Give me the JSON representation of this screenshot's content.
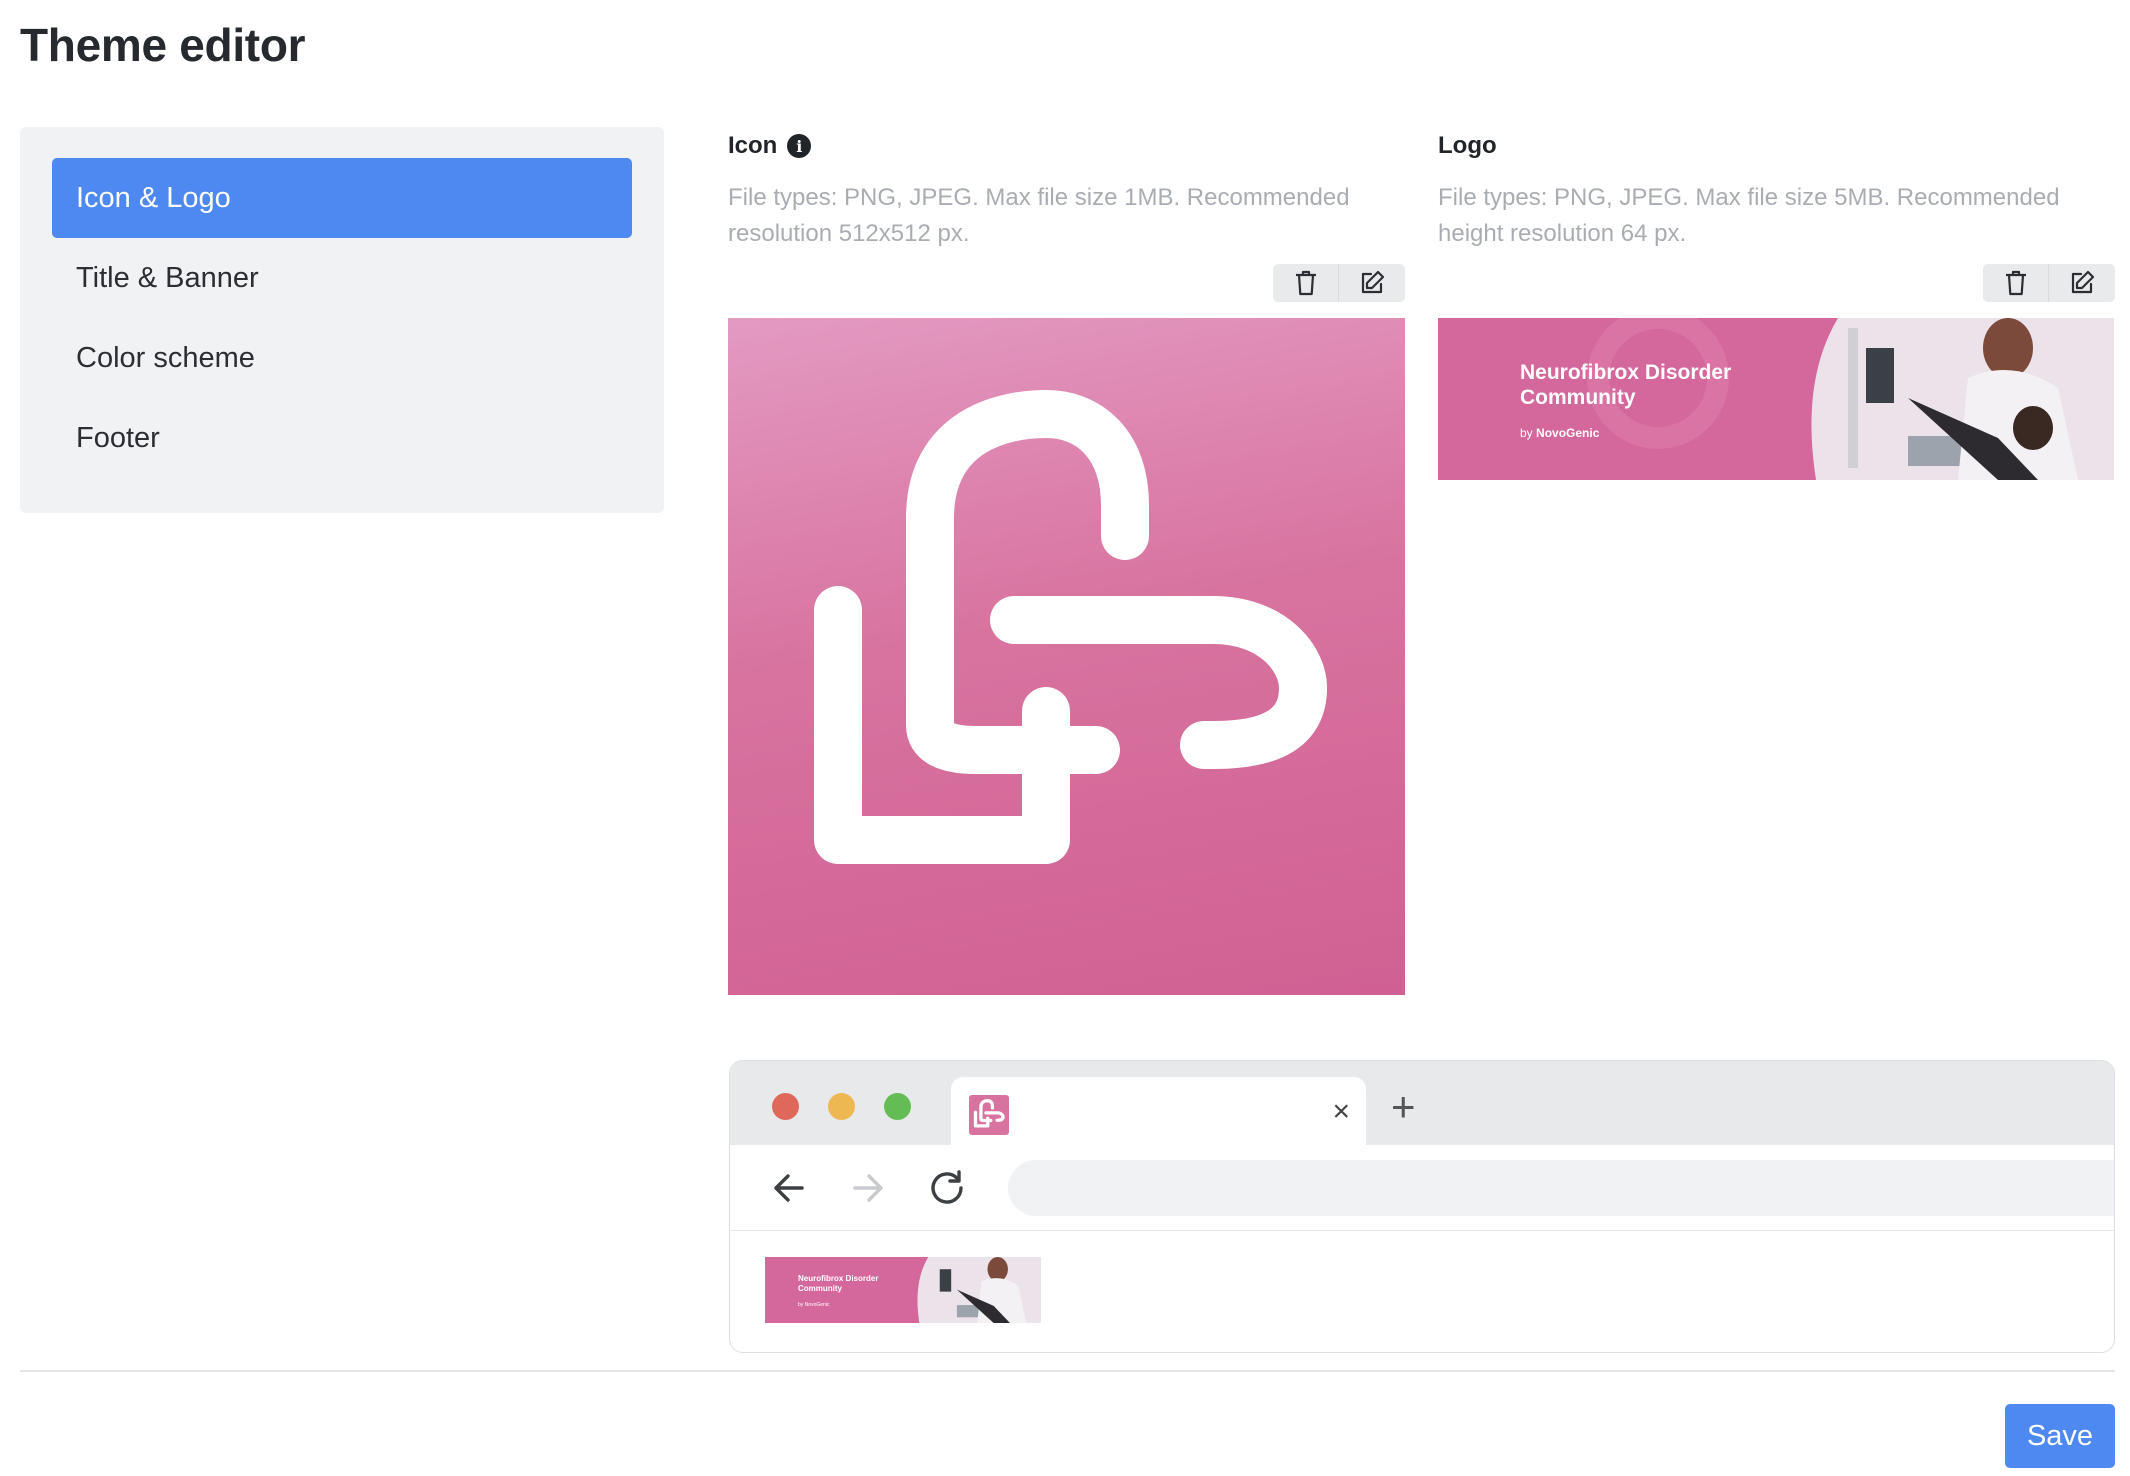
{
  "page": {
    "title": "Theme editor"
  },
  "sidebar": {
    "items": [
      {
        "label": "Icon & Logo",
        "active": true
      },
      {
        "label": "Title & Banner",
        "active": false
      },
      {
        "label": "Color scheme",
        "active": false
      },
      {
        "label": "Footer",
        "active": false
      }
    ]
  },
  "icon_section": {
    "label": "Icon",
    "info_icon": "info-icon",
    "helper": "File types: PNG, JPEG. Max file size 1MB. Recommended resolution 512x512 px.",
    "actions": [
      "trash-icon",
      "edit-icon"
    ]
  },
  "logo_section": {
    "label": "Logo",
    "helper": "File types: PNG, JPEG. Max file size 5MB. Recommended height resolution 64 px.",
    "actions": [
      "trash-icon",
      "edit-icon"
    ],
    "logo_text": {
      "title": "Neurofibrox Disorder Community",
      "by_prefix": "by",
      "by_brand": "NovoGenic"
    }
  },
  "browser_preview": {
    "window_dots": [
      "#e0685b",
      "#edb852",
      "#64bd54"
    ],
    "tab_close": "×",
    "new_tab": "+",
    "nav_icons": [
      "arrow-left-icon",
      "arrow-right-icon",
      "reload-icon"
    ]
  },
  "colors": {
    "accent": "#4e88f1",
    "brand_pink": "#d4679b"
  },
  "footer": {
    "save_label": "Save"
  }
}
